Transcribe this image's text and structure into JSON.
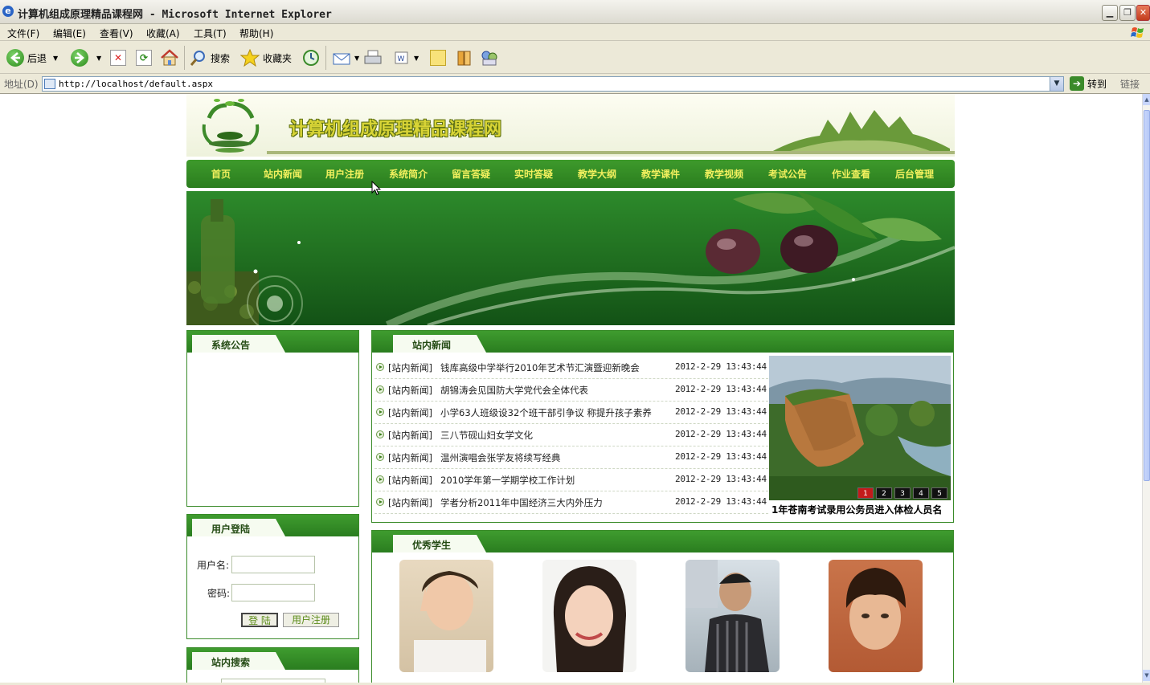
{
  "window": {
    "title": "计算机组成原理精品课程网 - Microsoft Internet Explorer"
  },
  "menu": [
    "文件(F)",
    "编辑(E)",
    "查看(V)",
    "收藏(A)",
    "工具(T)",
    "帮助(H)"
  ],
  "toolbar": {
    "back": "后退",
    "search": "搜索",
    "favorites": "收藏夹"
  },
  "address": {
    "label": "地址(D)",
    "url": "http://localhost/default.aspx",
    "go": "转到",
    "links": "链接"
  },
  "site": {
    "name": "计算机组成原理精品课程网"
  },
  "nav": [
    "首页",
    "站内新闻",
    "用户注册",
    "系统简介",
    "留言答疑",
    "实时答疑",
    "教学大纲",
    "教学课件",
    "教学视频",
    "考试公告",
    "作业查看",
    "后台管理"
  ],
  "announce": {
    "title": "系统公告"
  },
  "login": {
    "title": "用户登陆",
    "username_label": "用户名:",
    "password_label": "密码:",
    "login_button": "登 陆",
    "register_button": "用户注册"
  },
  "search": {
    "title": "站内搜索"
  },
  "news": {
    "title": "站内新闻",
    "items": [
      {
        "cat": "[站内新闻]",
        "title": "钱库高级中学举行2010年艺术节汇演暨迎新晚会",
        "date": "2012-2-29 13:43:44"
      },
      {
        "cat": "[站内新闻]",
        "title": "胡锦涛会见国防大学党代会全体代表",
        "date": "2012-2-29 13:43:44"
      },
      {
        "cat": "[站内新闻]",
        "title": "小学63人班级设32个班干部引争议 称提升孩子素养",
        "date": "2012-2-29 13:43:44"
      },
      {
        "cat": "[站内新闻]",
        "title": "三八节砚山妇女学文化",
        "date": "2012-2-29 13:43:44"
      },
      {
        "cat": "[站内新闻]",
        "title": "温州演唱会张学友将续写经典",
        "date": "2012-2-29 13:43:44"
      },
      {
        "cat": "[站内新闻]",
        "title": "2010学年第一学期学校工作计划",
        "date": "2012-2-29 13:43:44"
      },
      {
        "cat": "[站内新闻]",
        "title": "学者分析2011年中国经济三大内外压力",
        "date": "2012-2-29 13:43:44"
      }
    ],
    "slides": [
      "1",
      "2",
      "3",
      "4",
      "5"
    ],
    "caption": "1年苍南考试录用公务员进入体检人员名"
  },
  "students": {
    "title": "优秀学生"
  }
}
